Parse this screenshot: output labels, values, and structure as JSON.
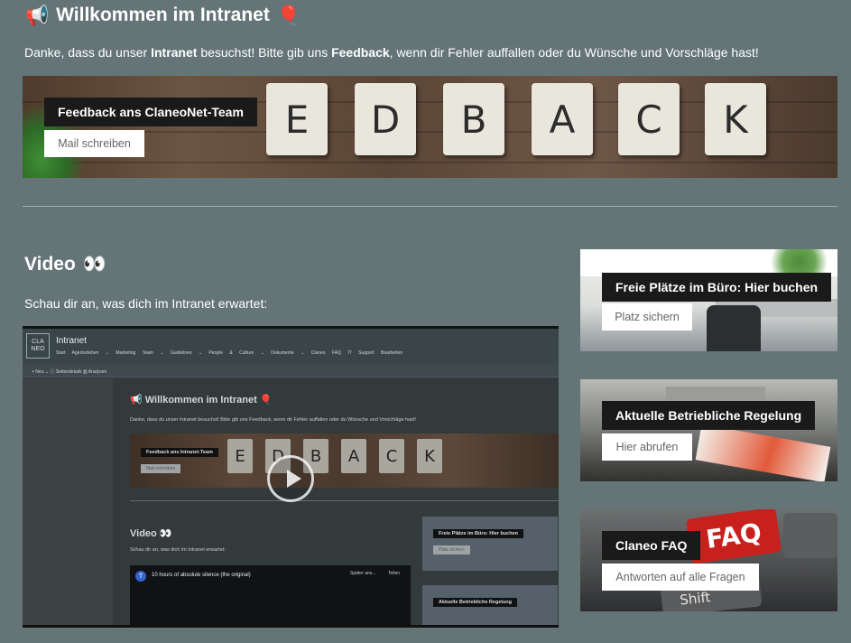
{
  "header": {
    "icon_left": "📢",
    "title": "Willkommen im Intranet",
    "icon_right": "🎈",
    "intro_pre": "Danke, dass du unser ",
    "intro_b1": "Intranet",
    "intro_mid": " besuchst! Bitte gib uns ",
    "intro_b2": "Feedback",
    "intro_post": ", wenn dir Fehler auffallen oder du Wünsche und Vorschläge hast!"
  },
  "feedback_banner": {
    "letters": [
      "E",
      "D",
      "B",
      "A",
      "C",
      "K"
    ],
    "caption": "Feedback ans ClaneoNet-Team",
    "button": "Mail schreiben"
  },
  "video": {
    "title": "Video",
    "title_icon": "👀",
    "subtitle": "Schau dir an, was dich im Intranet erwartet:",
    "preview": {
      "logo": "CLA\nNEO",
      "app_title": "Intranet",
      "nav": "Start Agenturleben ⌄ Marketing Team ⌄ Guidelines ⌄ People & Culture ⌄ Dokumente ⌄ Claneo FAQ IT Support Bearbeiten",
      "command_bar": "+ Neu ⌄   ⓘ Seitendetails   ▥ Analysen",
      "heading": "📢 Willkommen im Intranet 🎈",
      "intro": "Danke, dass du unser Intranet besuchst! Bitte gib uns Feedback, wenn dir Fehler auffallen oder du Wünsche und Vorschläge hast!",
      "banner_caption": "Feedback ans Intranet-Team",
      "banner_button": "Mail schreiben",
      "letters": [
        "E",
        "D",
        "B",
        "A",
        "C",
        "K"
      ],
      "video_title": "Video 👀",
      "video_subtitle": "Schau dir an, was dich im Intranet erwartet:",
      "yt_avatar": "T",
      "yt_title": "10 hours of absolute silence (the original)",
      "yt_watch_later": "Später ans...",
      "yt_share": "Teilen",
      "card1_caption": "Freie Plätze im Büro: Hier buchen",
      "card1_button": "Platz sichern",
      "card2_caption": "Aktuelle Betriebliche Regelung"
    }
  },
  "cards": [
    {
      "caption": "Freie Plätze im Büro: Hier buchen",
      "button": "Platz sichern"
    },
    {
      "caption": "Aktuelle Betriebliche Regelung",
      "button": "Hier abrufen"
    },
    {
      "caption": "Claneo FAQ",
      "button": "Antworten auf alle Fragen",
      "image_text": "FAQ",
      "key_text": "Shift"
    }
  ],
  "colors": {
    "page_bg": "#647477",
    "caption_bg": "#1a1a1a",
    "button_bg": "#ffffff",
    "button_text": "#666666",
    "faq_key": "#c8201c"
  }
}
